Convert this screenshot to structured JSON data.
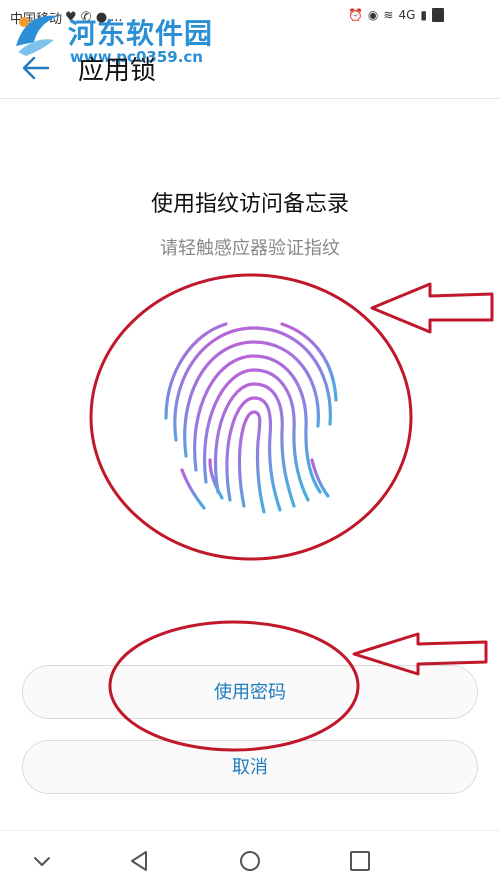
{
  "status_bar": {
    "carrier": "中国移动",
    "ellipsis": "...",
    "network": "4G"
  },
  "watermark": {
    "name": "河东软件园",
    "url": "www.pc0359.cn"
  },
  "app_bar": {
    "title": "应用锁",
    "back_icon": "arrow-left-icon"
  },
  "prompt": {
    "title": "使用指纹访问备忘录",
    "subtitle": "请轻触感应器验证指纹"
  },
  "buttons": {
    "use_password": "使用密码",
    "cancel": "取消"
  },
  "colors": {
    "accent": "#1e7bbd",
    "annotation": "#c0182a",
    "fingerprint_top": "#c15fd6",
    "fingerprint_bottom": "#4fa8e0",
    "watermark": "#2b8fd6"
  },
  "nav_icons": [
    "chevron-down-icon",
    "triangle-back-icon",
    "circle-home-icon",
    "square-recent-icon"
  ]
}
